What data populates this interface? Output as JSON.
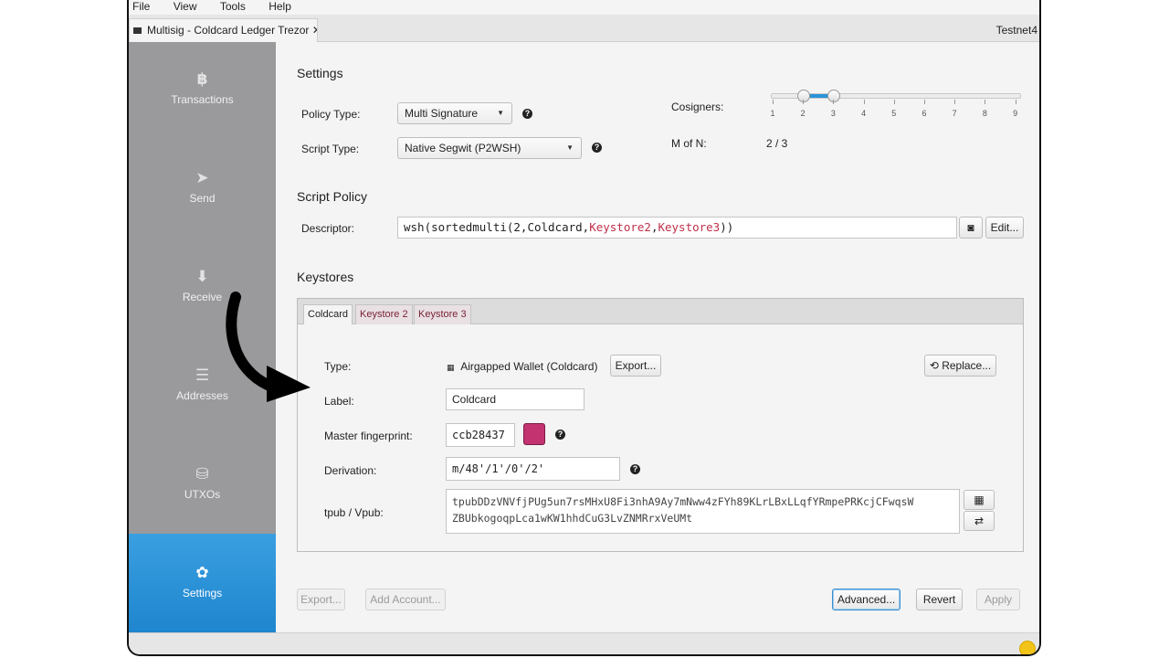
{
  "menu": [
    "File",
    "View",
    "Tools",
    "Help"
  ],
  "tab": {
    "title": "Multisig - Coldcard Ledger Trezor",
    "close": "✕"
  },
  "network": "Testnet4",
  "sidebar": [
    {
      "label": "Transactions",
      "icon": "bitcoin-icon",
      "glyph": "฿"
    },
    {
      "label": "Send",
      "icon": "send-icon",
      "glyph": "➤"
    },
    {
      "label": "Receive",
      "icon": "receive-icon",
      "glyph": "⬇"
    },
    {
      "label": "Addresses",
      "icon": "list-icon",
      "glyph": "☰"
    },
    {
      "label": "UTXOs",
      "icon": "coins-icon",
      "glyph": "⛁"
    },
    {
      "label": "Settings",
      "icon": "gear-icon",
      "glyph": "✿"
    }
  ],
  "settings": {
    "heading": "Settings",
    "policy_type_label": "Policy Type:",
    "policy_type_value": "Multi Signature",
    "script_type_label": "Script Type:",
    "script_type_value": "Native Segwit (P2WSH)",
    "cosigners_label": "Cosigners:",
    "cosigners_ticks": [
      "1",
      "2",
      "3",
      "4",
      "5",
      "6",
      "7",
      "8",
      "9"
    ],
    "cosigners_range": {
      "low": 2,
      "high": 3
    },
    "m_of_n_label": "M of N:",
    "m_of_n_value": "2 / 3"
  },
  "script_policy": {
    "heading": "Script Policy",
    "descriptor_label": "Descriptor:",
    "descriptor_prefix": "wsh(sortedmulti(2,Coldcard,",
    "descriptor_kw1": "Keystore2",
    "descriptor_sep": ",",
    "descriptor_kw2": "Keystore3",
    "descriptor_suffix": "))",
    "edit_label": "Edit..."
  },
  "keystores": {
    "heading": "Keystores",
    "tabs": [
      "Coldcard",
      "Keystore 2",
      "Keystore 3"
    ],
    "type_label": "Type:",
    "type_value": "Airgapped Wallet (Coldcard)",
    "export_label": "Export...",
    "replace_label": "Replace...",
    "label_label": "Label:",
    "label_value": "Coldcard",
    "fingerprint_label": "Master fingerprint:",
    "fingerprint_value": "ccb28437",
    "fingerprint_color": "#c2336f",
    "derivation_label": "Derivation:",
    "derivation_value": "m/48'/1'/0'/2'",
    "xpub_label": "tpub / Vpub:",
    "xpub_line1": "tpubDDzVNVfjPUg5un7rsMHxU8Fi3nhA9Ay7mNww4zFYh89KLrLBxLLqfYRmpePRKcjCFwqsW",
    "xpub_line2": "ZBUbkogoqpLca1wKW1hhdCuG3LvZNMRrxVeUMt"
  },
  "footer": {
    "export": "Export...",
    "add_account": "Add Account...",
    "advanced": "Advanced...",
    "revert": "Revert",
    "apply": "Apply"
  },
  "colors": {
    "accent": "#2a94d8",
    "sidebar": "#9a9a9d",
    "keyword": "#c0304a"
  }
}
